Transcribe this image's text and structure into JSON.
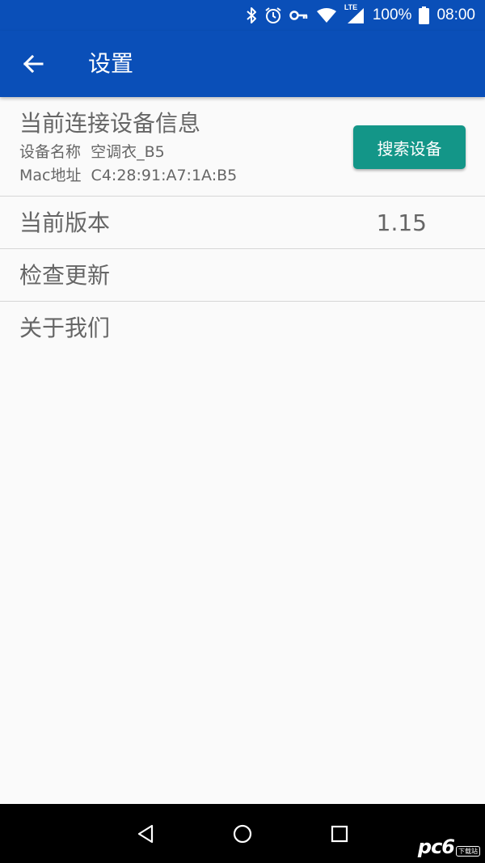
{
  "status_bar": {
    "network": "LTE",
    "battery": "100%",
    "time": "08:00",
    "icons": [
      "bluetooth-icon",
      "alarm-icon",
      "vpn-key-icon",
      "wifi-icon",
      "signal-icon",
      "battery-icon"
    ]
  },
  "app_bar": {
    "title": "设置",
    "back_icon": "arrow-back-icon"
  },
  "device_info": {
    "title": "当前连接设备信息",
    "name_line": "设备名称  空调衣_B5",
    "mac_line": "Mac地址  C4:28:91:A7:1A:B5",
    "search_button": "搜索设备"
  },
  "version": {
    "label": "当前版本",
    "value": "1.15"
  },
  "check_update": {
    "label": "检查更新"
  },
  "about": {
    "label": "关于我们"
  },
  "nav_bar": {
    "icons": [
      "back-triangle-icon",
      "home-circle-icon",
      "recents-square-icon"
    ]
  },
  "watermark": {
    "text": "pc6",
    "badge": "下载站"
  },
  "colors": {
    "primary": "#0a4fb8",
    "accent": "#139688",
    "text": "#666666",
    "background": "#fafafa"
  }
}
